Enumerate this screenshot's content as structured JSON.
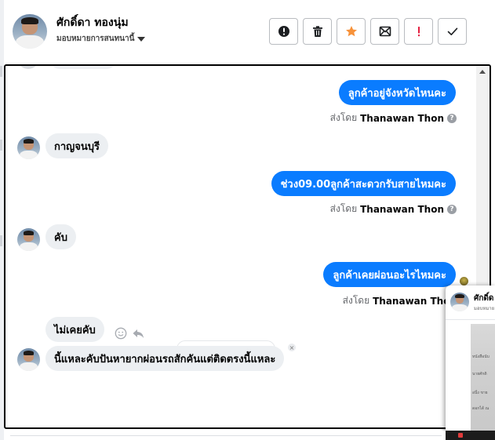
{
  "header": {
    "contact_name": "ศักดิ์ดา ทองนุ่ม",
    "assign_label": "มอบหมายการสนทนานี้",
    "actions": [
      {
        "icon": "alert-circle-icon",
        "color": "#1c1e21"
      },
      {
        "icon": "trash-icon",
        "color": "#1c1e21"
      },
      {
        "icon": "star-icon",
        "color": "#f7923a"
      },
      {
        "icon": "mark-unread-mail-icon",
        "color": "#1c1e21"
      },
      {
        "icon": "exclamation-icon",
        "color": "#e41e3f"
      },
      {
        "icon": "checkmark-icon",
        "color": "#1c1e21"
      }
    ]
  },
  "conversation": {
    "sender_prefix": "ส่งโดย",
    "messages": [
      {
        "direction": "out",
        "text": "ลูกค้าอยู่จังหวัดไหนคะ",
        "sent_by": "Thanawan Thon"
      },
      {
        "direction": "in",
        "text": "กาญจนบุรี"
      },
      {
        "direction": "out",
        "text": "ช่วง09.00ลูกค้าสะดวกรับสายไหมคะ",
        "sent_by": "Thanawan Thon"
      },
      {
        "direction": "in",
        "text": "คับ"
      },
      {
        "direction": "out",
        "text": "ลูกค้าเคยผ่อนอะไรไหมคะ",
        "sent_by": "Thanawan Thon"
      },
      {
        "direction": "in",
        "text": "ไม่เคยคับ"
      },
      {
        "direction": "in",
        "text": "นี้แหละคับปันหายากผ่อนรถสักคันแต่ติดตรงนี้แหละ"
      }
    ],
    "info_glyph": "?"
  },
  "preview": {
    "name": "ศักดิ์ด",
    "subtitle": "มอบหมาย",
    "doc_lines": [
      "หนังสือนับ",
      "นายศักดิ",
      "อนึ่ง ขาย",
      "ดอกได้ ณ"
    ]
  },
  "colors": {
    "accent": "#0a7cff",
    "incoming_bubble": "#eceff2",
    "muted_text": "#65676b"
  }
}
